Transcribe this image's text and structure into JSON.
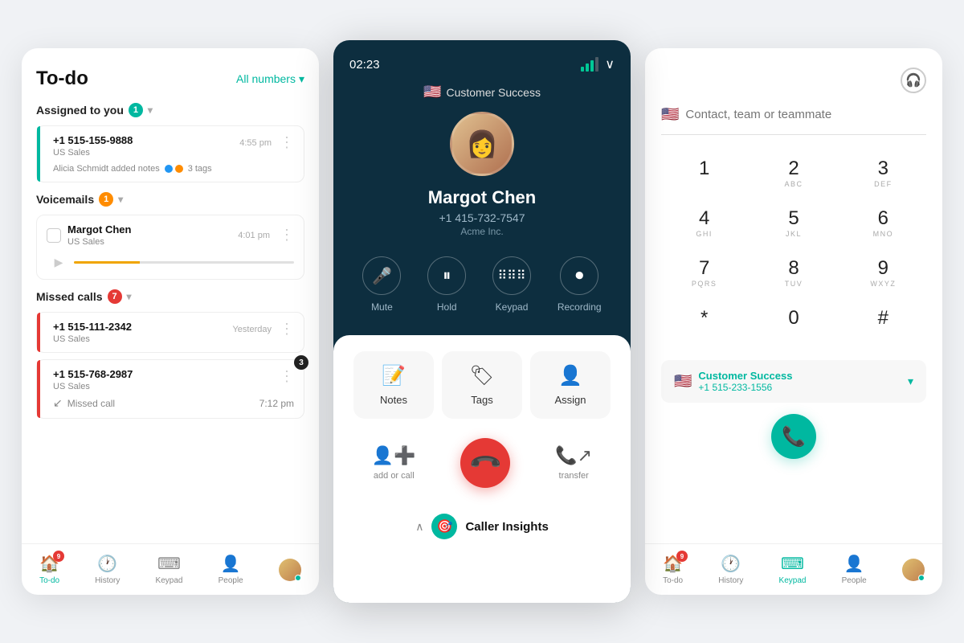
{
  "left": {
    "title": "To-do",
    "filter_label": "All numbers",
    "sections": [
      {
        "label": "Assigned to you",
        "count": "1",
        "items": [
          {
            "number": "+1 515-155-9888",
            "sublabel": "US Sales",
            "time": "4:55 pm",
            "bar_color": "bar-green",
            "tags_text": "3 tags",
            "note": "Alicia Schmidt added notes"
          }
        ]
      },
      {
        "label": "Voicemails",
        "count": "1",
        "items": [
          {
            "name": "Margot Chen",
            "sublabel": "US Sales",
            "time": "4:01 pm"
          }
        ]
      },
      {
        "label": "Missed calls",
        "count": "7",
        "items": [
          {
            "number": "+1 515-111-2342",
            "sublabel": "US Sales",
            "time": "Yesterday",
            "bar_color": "bar-red"
          },
          {
            "number": "+1 515-768-2987",
            "sublabel": "US Sales",
            "time": "7:12 pm",
            "bar_color": "bar-red",
            "badge": "3",
            "note": "Missed call"
          }
        ]
      }
    ],
    "nav": [
      {
        "label": "To-do",
        "icon": "🏠",
        "active": true,
        "badge": "9"
      },
      {
        "label": "History",
        "icon": "🕐",
        "active": false
      },
      {
        "label": "Keypad",
        "icon": "⌨",
        "active": false
      },
      {
        "label": "People",
        "icon": "👤",
        "active": false
      }
    ]
  },
  "middle": {
    "timer": "02:23",
    "team": "Customer Success",
    "caller_name": "Margot Chen",
    "caller_number": "+1 415-732-7547",
    "caller_company": "Acme Inc.",
    "controls": [
      {
        "label": "Mute",
        "icon": "🎤"
      },
      {
        "label": "Hold",
        "icon": "⏸"
      },
      {
        "label": "Keypad",
        "icon": "⠿"
      },
      {
        "label": "Recording",
        "icon": "⏺"
      }
    ],
    "actions": [
      {
        "label": "Notes",
        "icon": "📝"
      },
      {
        "label": "Tags",
        "icon": "🏷"
      },
      {
        "label": "Assign",
        "icon": "👤"
      }
    ],
    "call_actions": [
      {
        "label": "add or call",
        "icon": "👤"
      },
      {
        "label": "transfer",
        "icon": "📞"
      }
    ],
    "insights_label": "Caller Insights"
  },
  "right": {
    "contact_placeholder": "Contact, team or teammate",
    "keys": [
      {
        "num": "1",
        "letters": ""
      },
      {
        "num": "2",
        "letters": "ABC"
      },
      {
        "num": "3",
        "letters": "DEF"
      },
      {
        "num": "4",
        "letters": "GHI"
      },
      {
        "num": "5",
        "letters": "JKL"
      },
      {
        "num": "6",
        "letters": "MNO"
      },
      {
        "num": "7",
        "letters": "PQRS"
      },
      {
        "num": "8",
        "letters": "TUV"
      },
      {
        "num": "9",
        "letters": "WXYZ"
      },
      {
        "num": "*",
        "letters": ""
      },
      {
        "num": "0",
        "letters": ""
      },
      {
        "num": "#",
        "letters": ""
      }
    ],
    "selected_line_name": "Customer Success",
    "selected_line_number": "+1 515-233-1556",
    "nav": [
      {
        "label": "To-do",
        "icon": "🏠",
        "active": false,
        "badge": "9"
      },
      {
        "label": "History",
        "icon": "🕐",
        "active": false
      },
      {
        "label": "Keypad",
        "icon": "⌨",
        "active": true
      },
      {
        "label": "People",
        "icon": "👤",
        "active": false
      }
    ]
  }
}
